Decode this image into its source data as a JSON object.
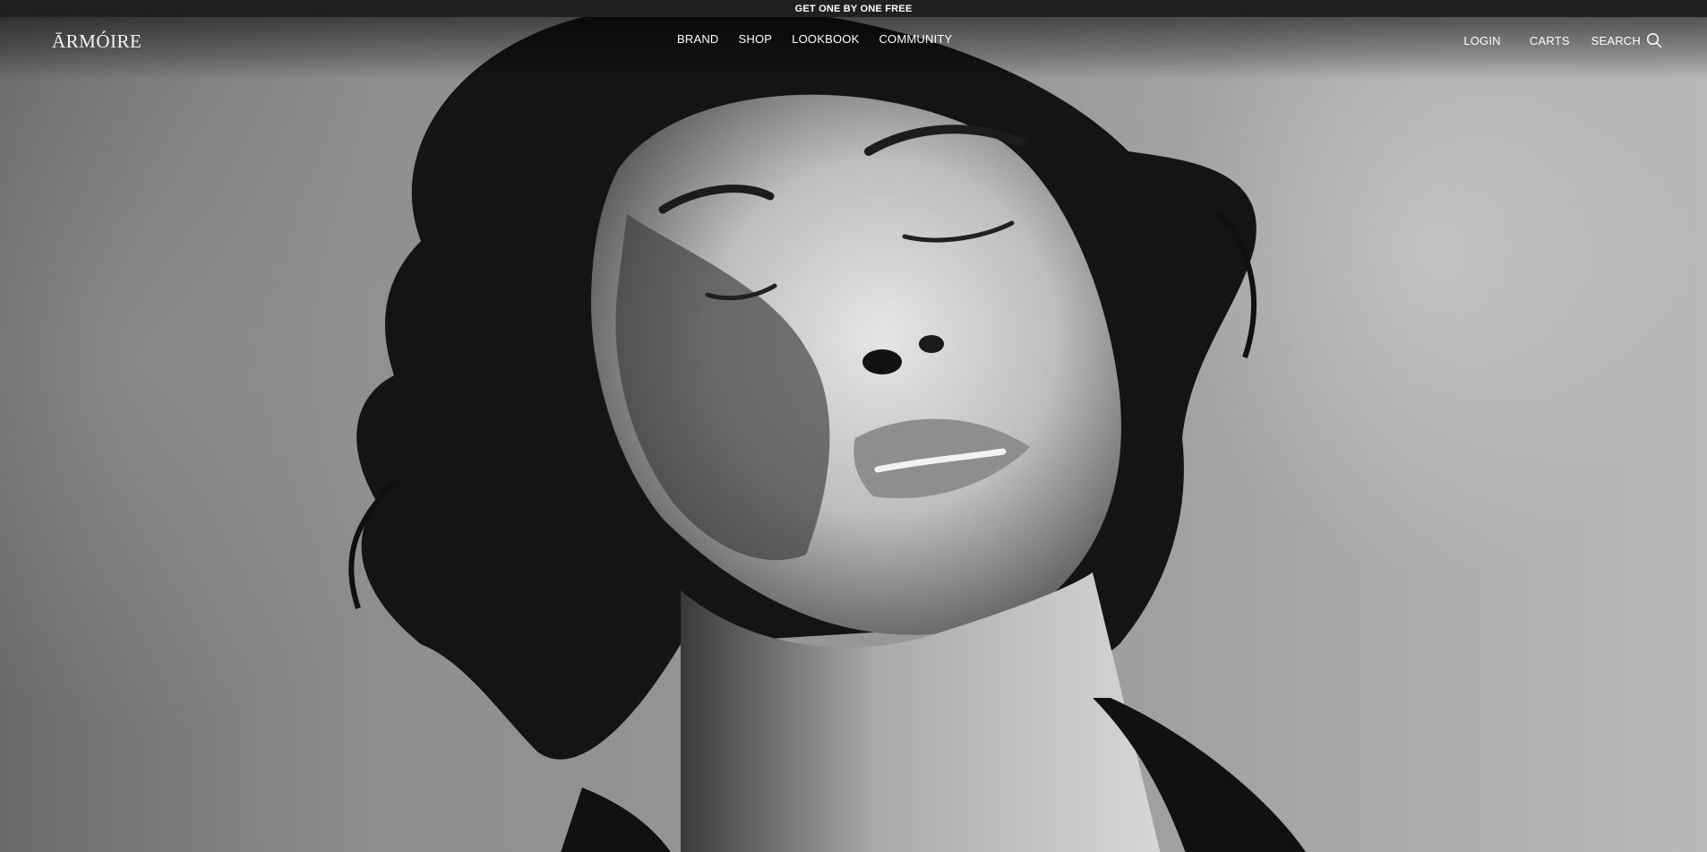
{
  "announcement": {
    "text": "GET ONE BY ONE FREE"
  },
  "header": {
    "logo": "ĀRMÓIRE",
    "nav": [
      {
        "label": "BRAND"
      },
      {
        "label": "SHOP"
      },
      {
        "label": "LOOKBOOK"
      },
      {
        "label": "COMMUNITY"
      }
    ],
    "utility": {
      "login": "LOGIN",
      "carts": "CARTS",
      "search": "SEARCH",
      "search_icon": "search-icon"
    }
  },
  "hero": {
    "image": "black-and-white portrait hero"
  },
  "colors": {
    "announcement_bg": "#1f2022",
    "nav_text": "#ffffff"
  }
}
